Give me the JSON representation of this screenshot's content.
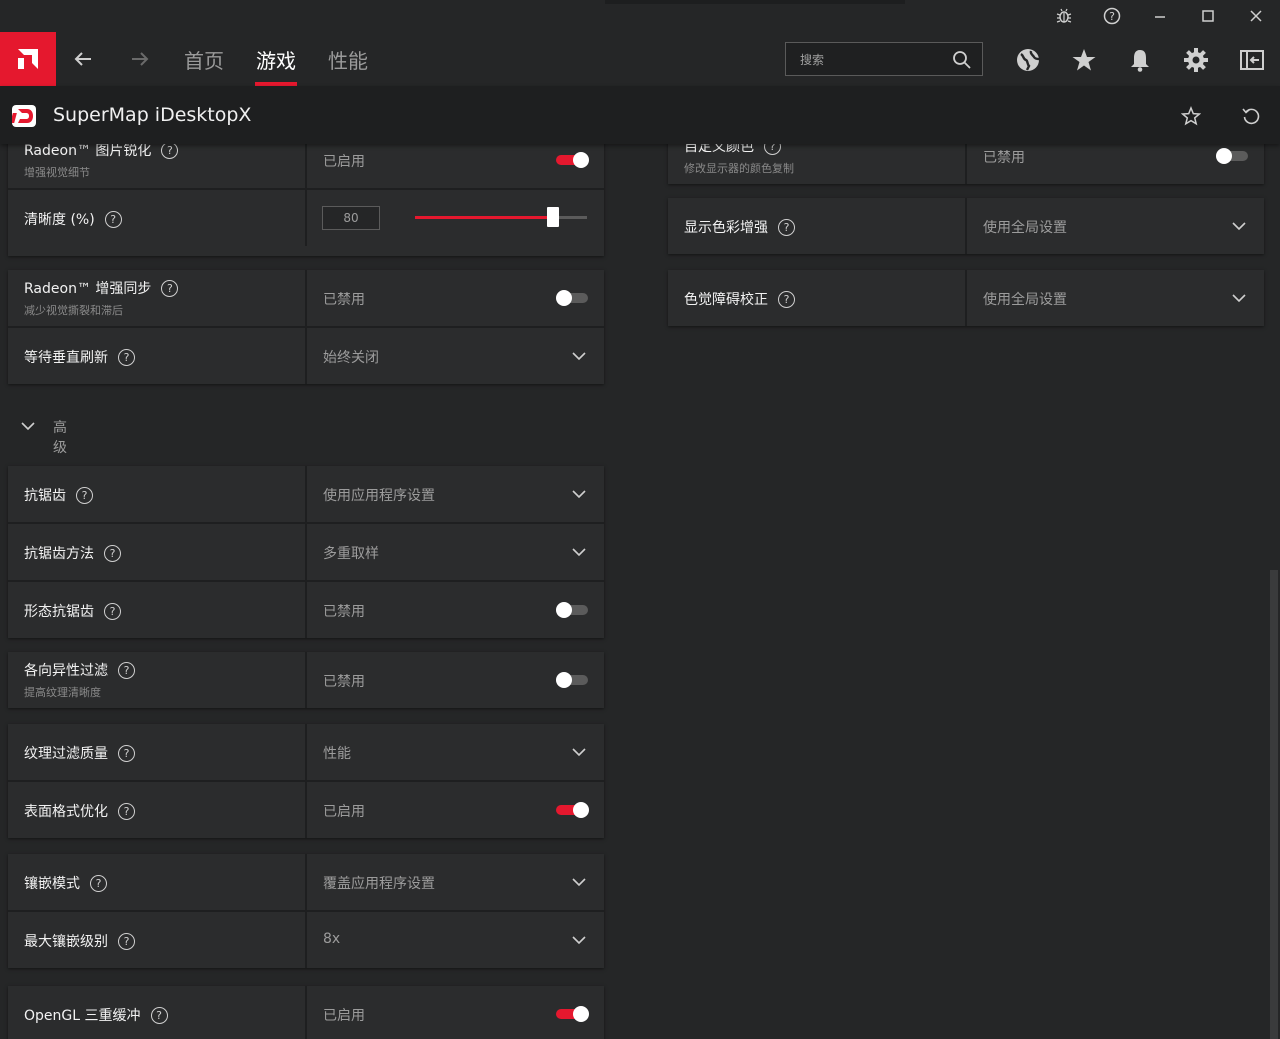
{
  "titlebar": {
    "icons": [
      "bug-icon",
      "help-icon",
      "minimize-icon",
      "maximize-icon",
      "close-icon"
    ]
  },
  "nav": {
    "back_icon": "arrow-left-icon",
    "forward_icon": "arrow-right-icon",
    "tabs": [
      {
        "label": "首页"
      },
      {
        "label": "游戏"
      },
      {
        "label": "性能"
      }
    ],
    "search_placeholder": "搜索",
    "right_icons": [
      "globe-icon",
      "star-icon",
      "bell-icon",
      "gear-icon",
      "sidebar-toggle-icon"
    ],
    "accent_color": "#e5182e"
  },
  "profile": {
    "title": "SuperMap iDesktopX",
    "icons": [
      "favorite-star-icon",
      "reset-icon"
    ]
  },
  "left": {
    "sharpening": {
      "title": "Radeon™ 图片锐化",
      "subtitle": "增强视觉细节",
      "value": "已启用",
      "on": true
    },
    "sharpness": {
      "title": "清晰度 (%)",
      "value": "80",
      "percent": 80
    },
    "enhanced_sync": {
      "title": "Radeon™ 增强同步",
      "subtitle": "减少视觉撕裂和滞后",
      "value": "已禁用",
      "on": false
    },
    "vsync": {
      "title": "等待垂直刷新",
      "value": "始终关闭"
    },
    "advanced_label": "高级",
    "antialiasing": {
      "title": "抗锯齿",
      "value": "使用应用程序设置"
    },
    "aa_method": {
      "title": "抗锯齿方法",
      "value": "多重取样"
    },
    "morph_aa": {
      "title": "形态抗锯齿",
      "value": "已禁用",
      "on": false
    },
    "anisotropic": {
      "title": "各向异性过滤",
      "subtitle": "提高纹理清晰度",
      "value": "已禁用",
      "on": false
    },
    "texture_quality": {
      "title": "纹理过滤质量",
      "value": "性能"
    },
    "surface_opt": {
      "title": "表面格式优化",
      "value": "已启用",
      "on": true
    },
    "tess_mode": {
      "title": "镶嵌模式",
      "value": "覆盖应用程序设置"
    },
    "tess_level": {
      "title": "最大镶嵌级别",
      "value": "8x"
    },
    "opengl_triple": {
      "title": "OpenGL 三重缓冲",
      "value": "已启用",
      "on": true
    }
  },
  "right": {
    "custom_color": {
      "title": "自定义颜色",
      "subtitle": "修改显示器的颜色复制",
      "value": "已禁用",
      "on": false
    },
    "color_enhance": {
      "title": "显示色彩增强",
      "value": "使用全局设置"
    },
    "color_blind": {
      "title": "色觉障碍校正",
      "value": "使用全局设置"
    }
  }
}
